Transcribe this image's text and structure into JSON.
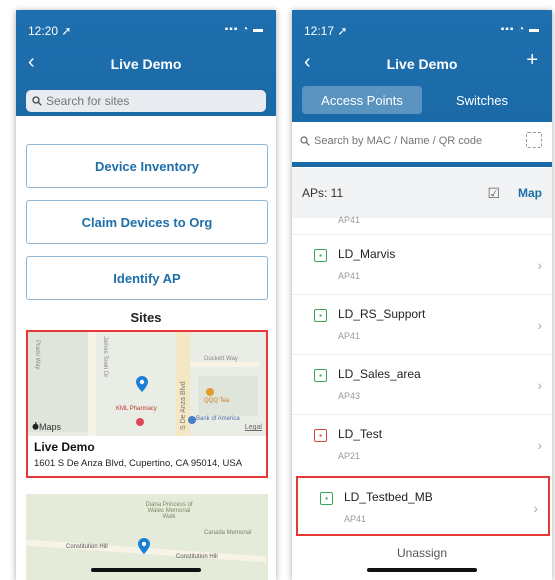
{
  "left_screen": {
    "time": "12:20 ➚",
    "status_icons": "▪▪▪ ◔ ▬",
    "back": "‹",
    "title": "Live Demo",
    "search_placeholder": "Search for sites",
    "buttons": [
      "Device Inventory",
      "Claim Devices to Org",
      "Identify AP"
    ],
    "sites_label": "Sites",
    "site": {
      "name": "Live Demo",
      "address": "1601 S De Anza Blvd, Cupertino, CA 95014, USA",
      "maps_label": "Maps",
      "legal_label": "Legal",
      "map_labels": [
        "Duckett Way",
        "KML Pharmacy",
        "QQQ Tea",
        "S De Anza Blvd",
        "Bank of America",
        "Prado Way",
        "James Town Dr"
      ]
    },
    "map2_labels": [
      "Diana Princess of Wales Memorial Walk",
      "Canada Memorial",
      "Constitution Hill",
      "Constitution Hill"
    ]
  },
  "right_screen": {
    "time": "12:17 ➚",
    "status_icons": "▪▪▪ ◔ ▬",
    "back": "‹",
    "plus": "+",
    "title": "Live Demo",
    "tabs": [
      {
        "label": "Access Points",
        "active": true
      },
      {
        "label": "Switches",
        "active": false
      }
    ],
    "search_placeholder": "Search by MAC / Name / QR code",
    "ap_count": "APs: 11",
    "map_link": "Map",
    "cut_model": "AP41",
    "aps": [
      {
        "name": "LD_Marvis",
        "model": "AP41",
        "status": "green"
      },
      {
        "name": "LD_RS_Support",
        "model": "AP41",
        "status": "green"
      },
      {
        "name": "LD_Sales_area",
        "model": "AP43",
        "status": "green"
      },
      {
        "name": "LD_Test",
        "model": "AP21",
        "status": "red"
      },
      {
        "name": "LD_Testbed_MB",
        "model": "AP41",
        "status": "green",
        "highlighted": true
      }
    ],
    "unassign_label": "Unassign"
  },
  "colors": {
    "header_blue": "#1b6aa8",
    "link_blue": "#1e6ea8",
    "highlight_red": "#e53935",
    "status_green": "#3aa55a",
    "status_red": "#d64545"
  }
}
